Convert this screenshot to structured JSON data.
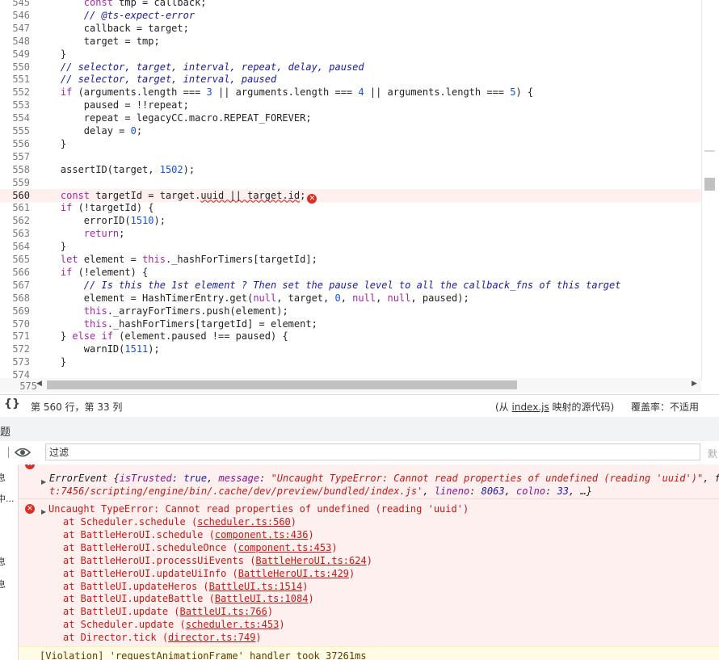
{
  "editor": {
    "lines": [
      {
        "n": "545",
        "segs": [
          [
            "        ",
            ""
          ],
          [
            "const",
            "kw"
          ],
          [
            " tmp = callback;",
            ""
          ]
        ]
      },
      {
        "n": "546",
        "segs": [
          [
            "        ",
            ""
          ],
          [
            "// @ts-expect-error",
            "cm"
          ]
        ]
      },
      {
        "n": "547",
        "segs": [
          [
            "        callback = target;",
            ""
          ]
        ]
      },
      {
        "n": "548",
        "segs": [
          [
            "        target = tmp;",
            ""
          ]
        ]
      },
      {
        "n": "549",
        "segs": [
          [
            "    }",
            ""
          ]
        ]
      },
      {
        "n": "550",
        "segs": [
          [
            "    ",
            ""
          ],
          [
            "// selector, target, interval, repeat, delay, paused",
            "cm"
          ]
        ]
      },
      {
        "n": "551",
        "segs": [
          [
            "    ",
            ""
          ],
          [
            "// selector, target, interval, paused",
            "cm"
          ]
        ]
      },
      {
        "n": "552",
        "segs": [
          [
            "    ",
            ""
          ],
          [
            "if",
            "kw"
          ],
          [
            " (arguments.length === ",
            ""
          ],
          [
            "3",
            "nm"
          ],
          [
            " || arguments.length === ",
            ""
          ],
          [
            "4",
            "nm"
          ],
          [
            " || arguments.length === ",
            ""
          ],
          [
            "5",
            "nm"
          ],
          [
            ") {",
            ""
          ]
        ]
      },
      {
        "n": "553",
        "segs": [
          [
            "        paused = !!repeat;",
            ""
          ]
        ]
      },
      {
        "n": "554",
        "segs": [
          [
            "        repeat = legacyCC.macro.REPEAT_FOREVER;",
            ""
          ]
        ]
      },
      {
        "n": "555",
        "segs": [
          [
            "        delay = ",
            ""
          ],
          [
            "0",
            "nm"
          ],
          [
            ";",
            ""
          ]
        ]
      },
      {
        "n": "556",
        "segs": [
          [
            "    }",
            ""
          ]
        ]
      },
      {
        "n": "557",
        "segs": []
      },
      {
        "n": "558",
        "segs": [
          [
            "    assertID(target, ",
            ""
          ],
          [
            "1502",
            "nm"
          ],
          [
            ");",
            ""
          ]
        ]
      },
      {
        "n": "559",
        "segs": []
      },
      {
        "n": "560",
        "segs": [
          [
            "    ",
            ""
          ],
          [
            "const",
            "kw"
          ],
          [
            " targetId = target.",
            ""
          ],
          [
            "uuid || target.id",
            "squig"
          ],
          [
            ";",
            ""
          ]
        ],
        "error": true
      },
      {
        "n": "561",
        "segs": [
          [
            "    ",
            ""
          ],
          [
            "if",
            "kw"
          ],
          [
            " (!targetId) {",
            ""
          ]
        ]
      },
      {
        "n": "562",
        "segs": [
          [
            "        errorID(",
            ""
          ],
          [
            "1510",
            "nm"
          ],
          [
            ");",
            ""
          ]
        ]
      },
      {
        "n": "563",
        "segs": [
          [
            "        ",
            ""
          ],
          [
            "return",
            "kw"
          ],
          [
            ";",
            ""
          ]
        ]
      },
      {
        "n": "564",
        "segs": [
          [
            "    }",
            ""
          ]
        ]
      },
      {
        "n": "565",
        "segs": [
          [
            "    ",
            ""
          ],
          [
            "let",
            "kw"
          ],
          [
            " element = ",
            ""
          ],
          [
            "this",
            "kw"
          ],
          [
            "._hashForTimers[targetId];",
            ""
          ]
        ]
      },
      {
        "n": "566",
        "segs": [
          [
            "    ",
            ""
          ],
          [
            "if",
            "kw"
          ],
          [
            " (!element) {",
            ""
          ]
        ]
      },
      {
        "n": "567",
        "segs": [
          [
            "        ",
            ""
          ],
          [
            "// Is this the 1st element ? Then set the pause level to all the callback_fns of this target",
            "cm"
          ]
        ]
      },
      {
        "n": "568",
        "segs": [
          [
            "        element = HashTimerEntry.get(",
            ""
          ],
          [
            "null",
            "kw"
          ],
          [
            ", target, ",
            ""
          ],
          [
            "0",
            "nm"
          ],
          [
            ", ",
            ""
          ],
          [
            "null",
            "kw"
          ],
          [
            ", ",
            ""
          ],
          [
            "null",
            "kw"
          ],
          [
            ", paused);",
            ""
          ]
        ]
      },
      {
        "n": "569",
        "segs": [
          [
            "        ",
            ""
          ],
          [
            "this",
            "kw"
          ],
          [
            "._arrayForTimers.push(element);",
            ""
          ]
        ]
      },
      {
        "n": "570",
        "segs": [
          [
            "        ",
            ""
          ],
          [
            "this",
            "kw"
          ],
          [
            "._hashForTimers[targetId] = element;",
            ""
          ]
        ]
      },
      {
        "n": "571",
        "segs": [
          [
            "    } ",
            ""
          ],
          [
            "else",
            "kw"
          ],
          [
            " ",
            ""
          ],
          [
            "if",
            "kw"
          ],
          [
            " (element.paused !== paused) {",
            ""
          ]
        ]
      },
      {
        "n": "572",
        "segs": [
          [
            "        warnID(",
            ""
          ],
          [
            "1511",
            "nm"
          ],
          [
            ");",
            ""
          ]
        ]
      },
      {
        "n": "573",
        "segs": [
          [
            "    }",
            ""
          ]
        ]
      },
      {
        "n": "574",
        "segs": []
      }
    ],
    "last_line_number": "575",
    "error_marker": "✕"
  },
  "status_bar": {
    "braces_icon": "{}",
    "cursor_position": "第 560 行，第 33 列",
    "source_prefix": "(从 ",
    "source_file": "index.js",
    "source_suffix": " 映射的源代码)",
    "coverage": "覆盖率：不适用"
  },
  "drawer": {
    "title": "题"
  },
  "toolbar": {
    "filter_placeholder": "过滤",
    "default_levels": "默"
  },
  "sidebar": {
    "items": [
      "息",
      "中...",
      "息",
      "息"
    ]
  },
  "console": {
    "error_event": {
      "line1": [
        [
          "ErrorEvent {",
          "p"
        ],
        [
          "isTrusted",
          "k"
        ],
        [
          ": ",
          "p"
        ],
        [
          "true",
          "b"
        ],
        [
          ", ",
          "p"
        ],
        [
          "message",
          "k"
        ],
        [
          ": ",
          "p"
        ],
        [
          "\"Uncaught TypeError: Cannot read properties of undefined (reading 'uuid')\"",
          "s"
        ],
        [
          ", f",
          "p"
        ]
      ],
      "line2": [
        [
          "t:7456/scripting/engine/bin/.cache/dev/preview/bundled/index.js'",
          "s"
        ],
        [
          ", ",
          "p"
        ],
        [
          "lineno",
          "k"
        ],
        [
          ": ",
          "p"
        ],
        [
          "8063",
          "n"
        ],
        [
          ", ",
          "p"
        ],
        [
          "colno",
          "k"
        ],
        [
          ": ",
          "p"
        ],
        [
          "33",
          "n"
        ],
        [
          ", …}",
          "p"
        ]
      ]
    },
    "uncaught_error": {
      "message": "Uncaught TypeError: Cannot read properties of undefined (reading 'uuid')",
      "stack": [
        {
          "fn": "at Scheduler.schedule",
          "loc": "scheduler.ts:560"
        },
        {
          "fn": "at BattleHeroUI.schedule",
          "loc": "component.ts:436"
        },
        {
          "fn": "at BattleHeroUI.scheduleOnce",
          "loc": "component.ts:453"
        },
        {
          "fn": "at BattleHeroUI.processUiEvents",
          "loc": "BattleHeroUI.ts:624"
        },
        {
          "fn": "at BattleHeroUI.updateUiInfo",
          "loc": "BattleHeroUI.ts:429"
        },
        {
          "fn": "at BattleUI.updateHeros",
          "loc": "BattleUI.ts:1514"
        },
        {
          "fn": "at BattleUI.updateBattle",
          "loc": "BattleUI.ts:1084"
        },
        {
          "fn": "at BattleUI.update",
          "loc": "BattleUI.ts:766"
        },
        {
          "fn": "at Scheduler.update",
          "loc": "scheduler.ts:453"
        },
        {
          "fn": "at Director.tick",
          "loc": "director.ts:749"
        }
      ]
    },
    "violation": "[Violation] 'requestAnimationFrame' handler took 37261ms"
  },
  "colors": {
    "error_red": "#d93025",
    "error_bg": "#fff0f0",
    "warning_bg": "#fffbe5",
    "keyword": "#a626a4",
    "comment": "#1a1aa6"
  }
}
